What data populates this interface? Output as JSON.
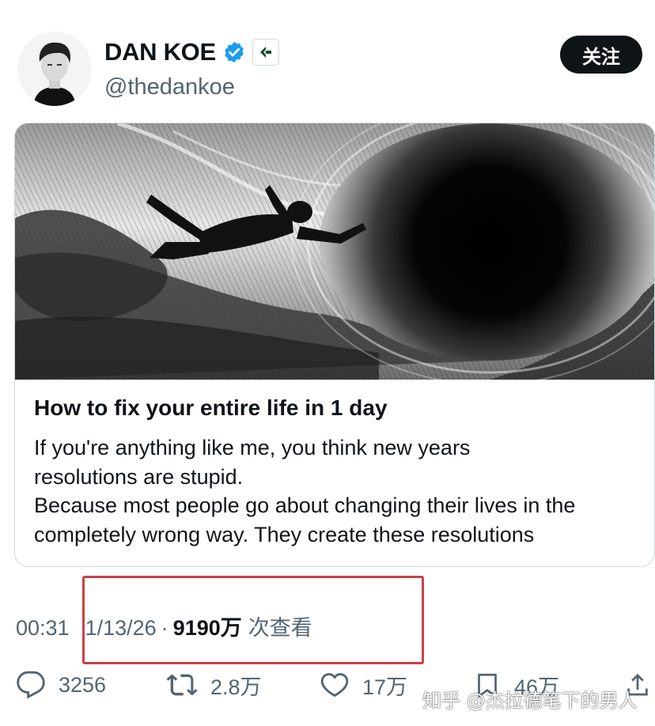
{
  "author": {
    "display_name": "DAN KOE",
    "handle": "@thedankoe",
    "avatar_icon": "avatar-portrait",
    "verified_color": "#1d9bf0"
  },
  "follow_button": {
    "label": "关注"
  },
  "card": {
    "title": "How to fix your entire life in 1 day",
    "excerpt_lines": [
      "If you're anything like me, you think new years",
      "resolutions are stupid.",
      "Because most people go about changing their lives in the",
      "completely wrong way. They create these resolutions"
    ]
  },
  "meta": {
    "time": "00:31",
    "date": "1/13/26",
    "separator": "·",
    "views": "9190万",
    "views_label": "次查看"
  },
  "actions": {
    "reply_count": "3256",
    "repost_count": "2.8万",
    "like_count": "17万",
    "bookmark_count": "46万"
  },
  "watermark": "知乎 @杰拉德笔下的男人",
  "colors": {
    "text": "#0f1419",
    "muted": "#536471",
    "verified": "#1d9bf0",
    "highlight": "#c94048"
  }
}
